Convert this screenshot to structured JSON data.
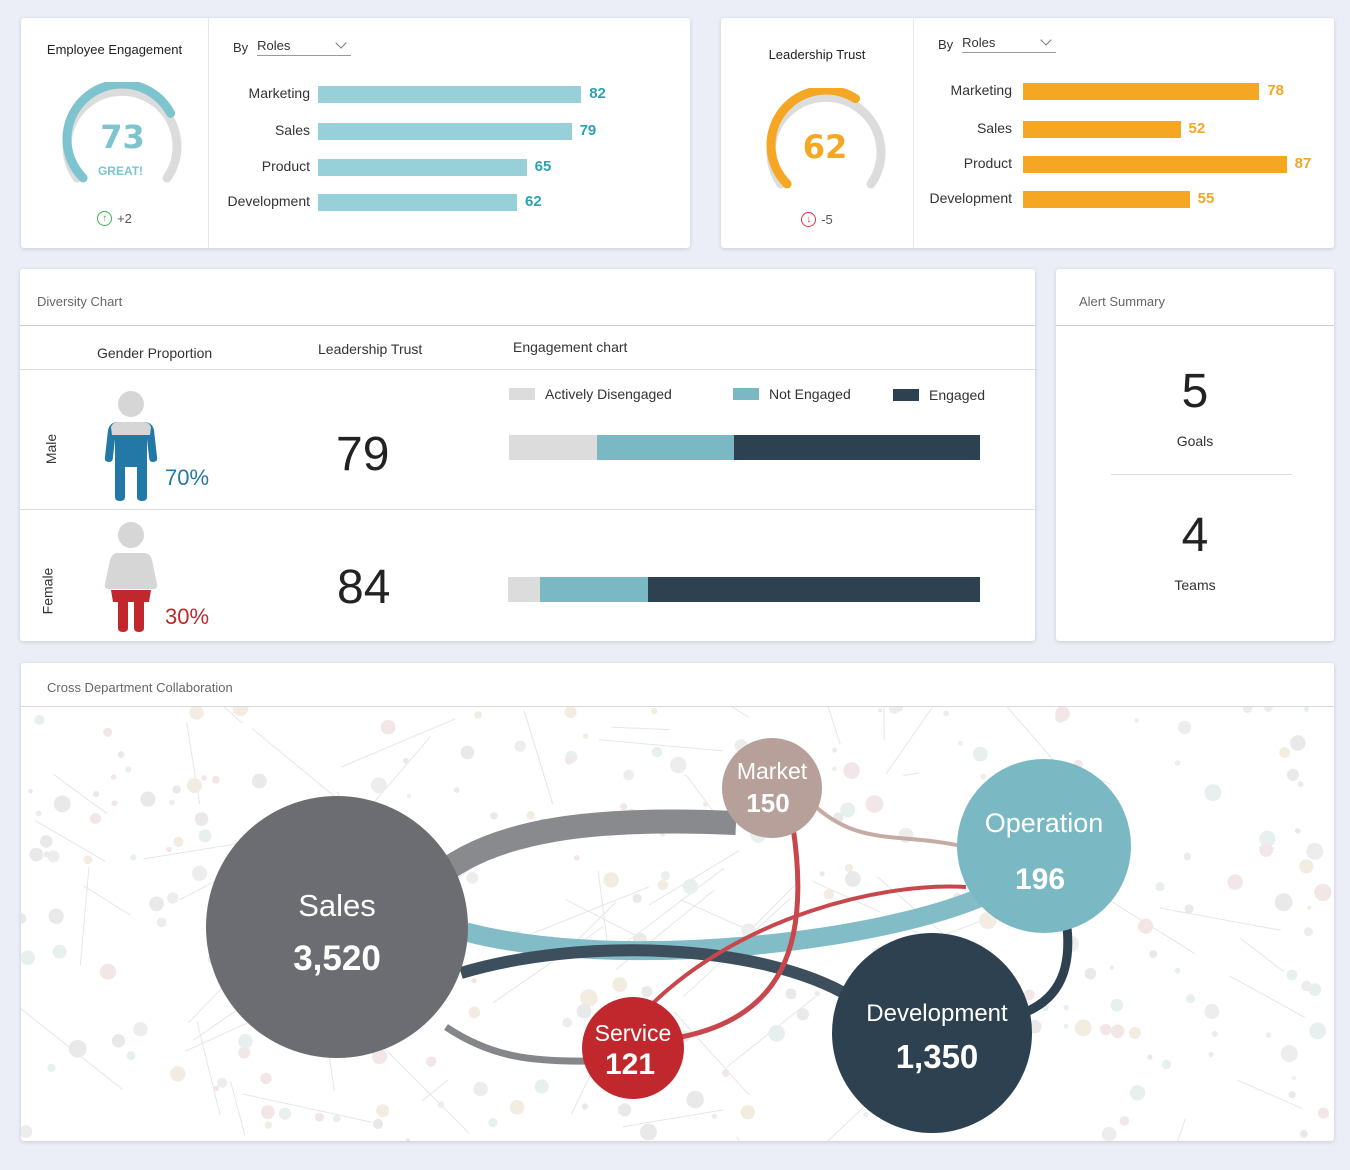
{
  "engagement_card": {
    "title": "Employee Engagement",
    "score": "73",
    "score_word": "GREAT!",
    "score_fraction": 0.73,
    "delta": "+2",
    "delta_icon": "arrow-up-circle-icon",
    "color": "#7ec4cf",
    "by_label": "By",
    "select_value": "Roles",
    "bars": [
      {
        "label": "Marketing",
        "value": 82,
        "display": "82"
      },
      {
        "label": "Sales",
        "value": 79,
        "display": "79"
      },
      {
        "label": "Product",
        "value": 65,
        "display": "65"
      },
      {
        "label": "Development",
        "value": 62,
        "display": "62"
      }
    ]
  },
  "trust_card": {
    "title": "Leadership Trust",
    "score": "62",
    "score_fraction": 0.62,
    "delta": "-5",
    "delta_icon": "arrow-down-circle-icon",
    "color": "#f5a623",
    "by_label": "By",
    "select_value": "Roles",
    "bars": [
      {
        "label": "Marketing",
        "value": 78,
        "display": "78"
      },
      {
        "label": "Sales",
        "value": 52,
        "display": "52"
      },
      {
        "label": "Product",
        "value": 87,
        "display": "87"
      },
      {
        "label": "Development",
        "value": 55,
        "display": "55"
      }
    ]
  },
  "diversity": {
    "title": "Diversity Chart",
    "headers": {
      "gender": "Gender Proportion",
      "trust": "Leadership Trust",
      "engagement": "Engagement chart"
    },
    "legend": [
      {
        "label": "Actively Disengaged",
        "color": "#dcdcdc"
      },
      {
        "label": "Not Engaged",
        "color": "#7ab8c3"
      },
      {
        "label": "Engaged",
        "color": "#2e4150"
      }
    ],
    "rows": [
      {
        "label": "Male",
        "percent": "70%",
        "trust": "79",
        "color": "#2279a8",
        "icon": "male-person-icon",
        "segments": [
          0.186,
          0.292,
          0.522
        ]
      },
      {
        "label": "Female",
        "percent": "30%",
        "trust": "84",
        "color": "#c0282d",
        "icon": "female-person-icon",
        "segments": [
          0.068,
          0.229,
          0.703
        ]
      }
    ]
  },
  "alert_summary": {
    "title": "Alert Summary",
    "items": [
      {
        "value": "5",
        "label": "Goals"
      },
      {
        "value": "4",
        "label": "Teams"
      }
    ]
  },
  "collaboration": {
    "title": "Cross Department Collaboration",
    "nodes": [
      {
        "id": "sales",
        "name": "Sales",
        "value": "3,520",
        "color": "#6c6d72"
      },
      {
        "id": "market",
        "name": "Market",
        "value": "150",
        "color": "#b8a09a"
      },
      {
        "id": "operation",
        "name": "Operation",
        "value": "196",
        "color": "#7ab8c3"
      },
      {
        "id": "development",
        "name": "Development",
        "value": "1,350",
        "color": "#2e4150"
      },
      {
        "id": "service",
        "name": "Service",
        "value": "121",
        "color": "#c0282d"
      }
    ]
  }
}
